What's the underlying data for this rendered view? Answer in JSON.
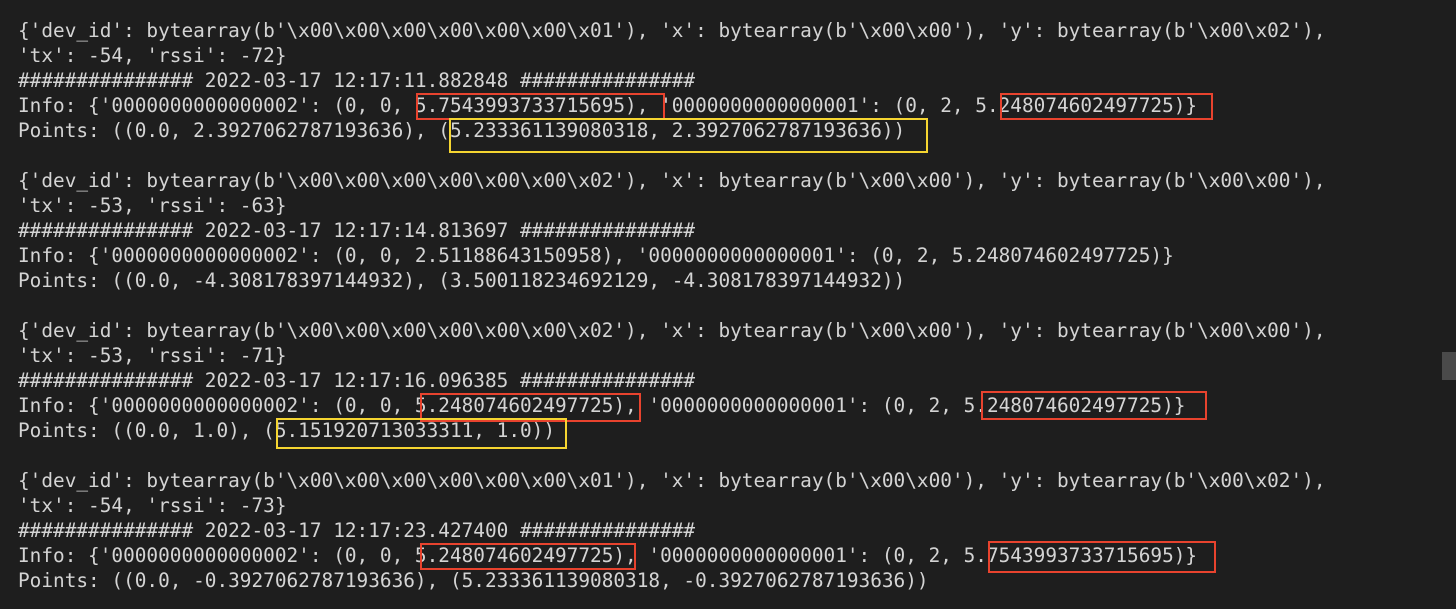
{
  "terminal": {
    "lines": [
      "{'dev_id': bytearray(b'\\x00\\x00\\x00\\x00\\x00\\x00\\x01'), 'x': bytearray(b'\\x00\\x00'), 'y': bytearray(b'\\x00\\x02'),",
      "'tx': -54, 'rssi': -72}",
      "############### 2022-03-17 12:17:11.882848 ###############",
      "Info: {'0000000000000002': (0, 0, 5.7543993733715695), '0000000000000001': (0, 2, 5.248074602497725)}",
      "Points: ((0.0, 2.3927062787193636), (5.233361139080318, 2.3927062787193636))",
      "",
      "{'dev_id': bytearray(b'\\x00\\x00\\x00\\x00\\x00\\x00\\x02'), 'x': bytearray(b'\\x00\\x00'), 'y': bytearray(b'\\x00\\x00'),",
      "'tx': -53, 'rssi': -63}",
      "############### 2022-03-17 12:17:14.813697 ###############",
      "Info: {'0000000000000002': (0, 0, 2.51188643150958), '0000000000000001': (0, 2, 5.248074602497725)}",
      "Points: ((0.0, -4.308178397144932), (3.500118234692129, -4.308178397144932))",
      "",
      "{'dev_id': bytearray(b'\\x00\\x00\\x00\\x00\\x00\\x00\\x02'), 'x': bytearray(b'\\x00\\x00'), 'y': bytearray(b'\\x00\\x00'),",
      "'tx': -53, 'rssi': -71}",
      "############### 2022-03-17 12:17:16.096385 ###############",
      "Info: {'0000000000000002': (0, 0, 5.248074602497725), '0000000000000001': (0, 2, 5.248074602497725)}",
      "Points: ((0.0, 1.0), (5.151920713033311, 1.0))",
      "",
      "{'dev_id': bytearray(b'\\x00\\x00\\x00\\x00\\x00\\x00\\x01'), 'x': bytearray(b'\\x00\\x00'), 'y': bytearray(b'\\x00\\x02'),",
      "'tx': -54, 'rssi': -73}",
      "############### 2022-03-17 12:17:23.427400 ###############",
      "Info: {'0000000000000002': (0, 0, 5.248074602497725), '0000000000000001': (0, 2, 5.7543993733715695)}",
      "Points: ((0.0, -0.3927062787193636), (5.233361139080318, -0.3927062787193636))"
    ]
  },
  "colors": {
    "background": "#1e1e1e",
    "text": "#d4d4d4",
    "highlight_red": "#e8432e",
    "highlight_yellow": "#f5d531",
    "scrollbar_thumb": "#4a4a4a"
  }
}
